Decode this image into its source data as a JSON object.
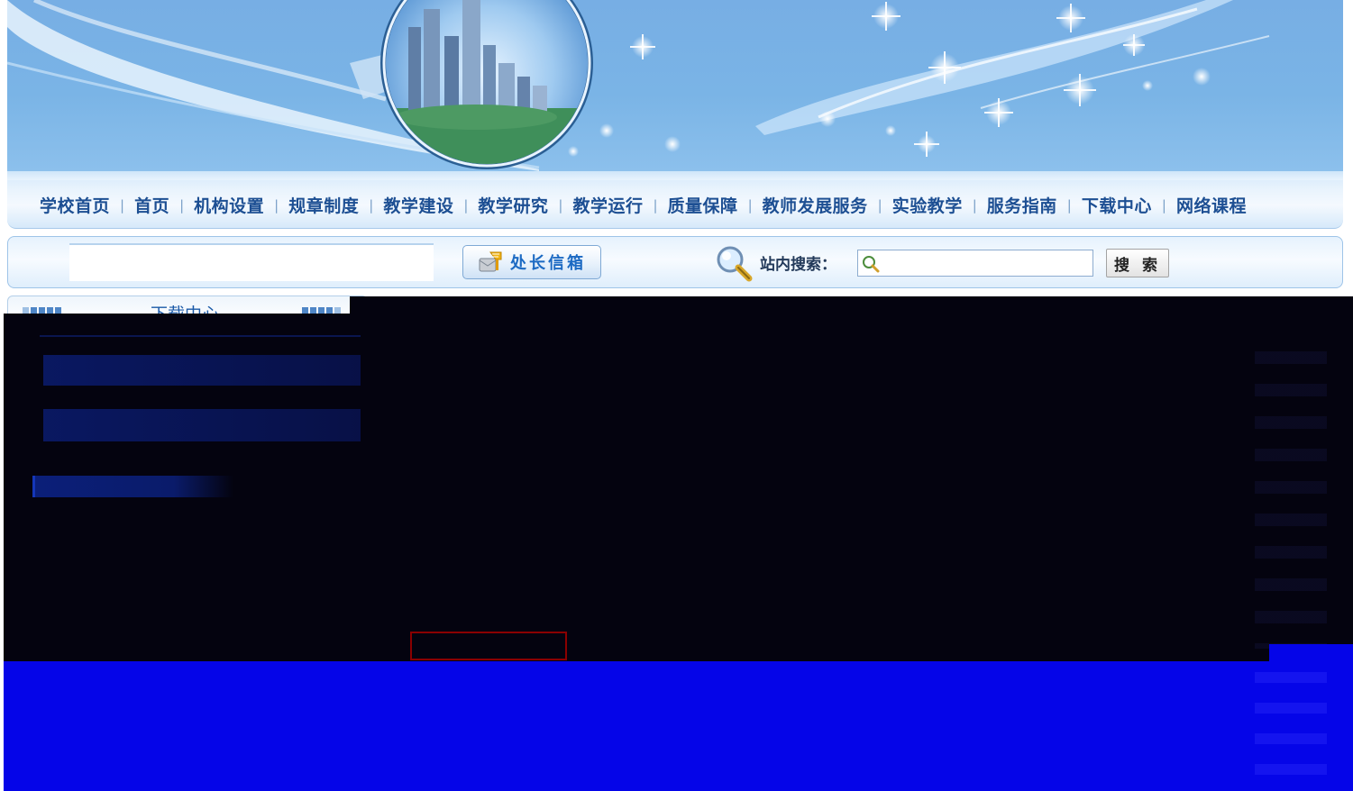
{
  "nav": {
    "items": [
      {
        "label": "学校首页"
      },
      {
        "label": "首页"
      },
      {
        "label": "机构设置"
      },
      {
        "label": "规章制度"
      },
      {
        "label": "教学建设"
      },
      {
        "label": "教学研究"
      },
      {
        "label": "教学运行"
      },
      {
        "label": "质量保障"
      },
      {
        "label": "教师发展服务"
      },
      {
        "label": "实验教学"
      },
      {
        "label": "服务指南"
      },
      {
        "label": "下载中心"
      },
      {
        "label": "网络课程"
      }
    ],
    "separator": "|"
  },
  "toolbar": {
    "mailbox_label": "处长信箱",
    "search_label": "站内搜索：",
    "search_value": "",
    "search_button_label": "搜 索"
  },
  "section": {
    "title": "下载中心"
  },
  "colors": {
    "banner_blue": "#7ab4e6",
    "nav_text": "#1d4f93",
    "overlay_dark": "#04030f",
    "overlay_blue": "#0505e8",
    "highlight_border": "#8a0000"
  }
}
